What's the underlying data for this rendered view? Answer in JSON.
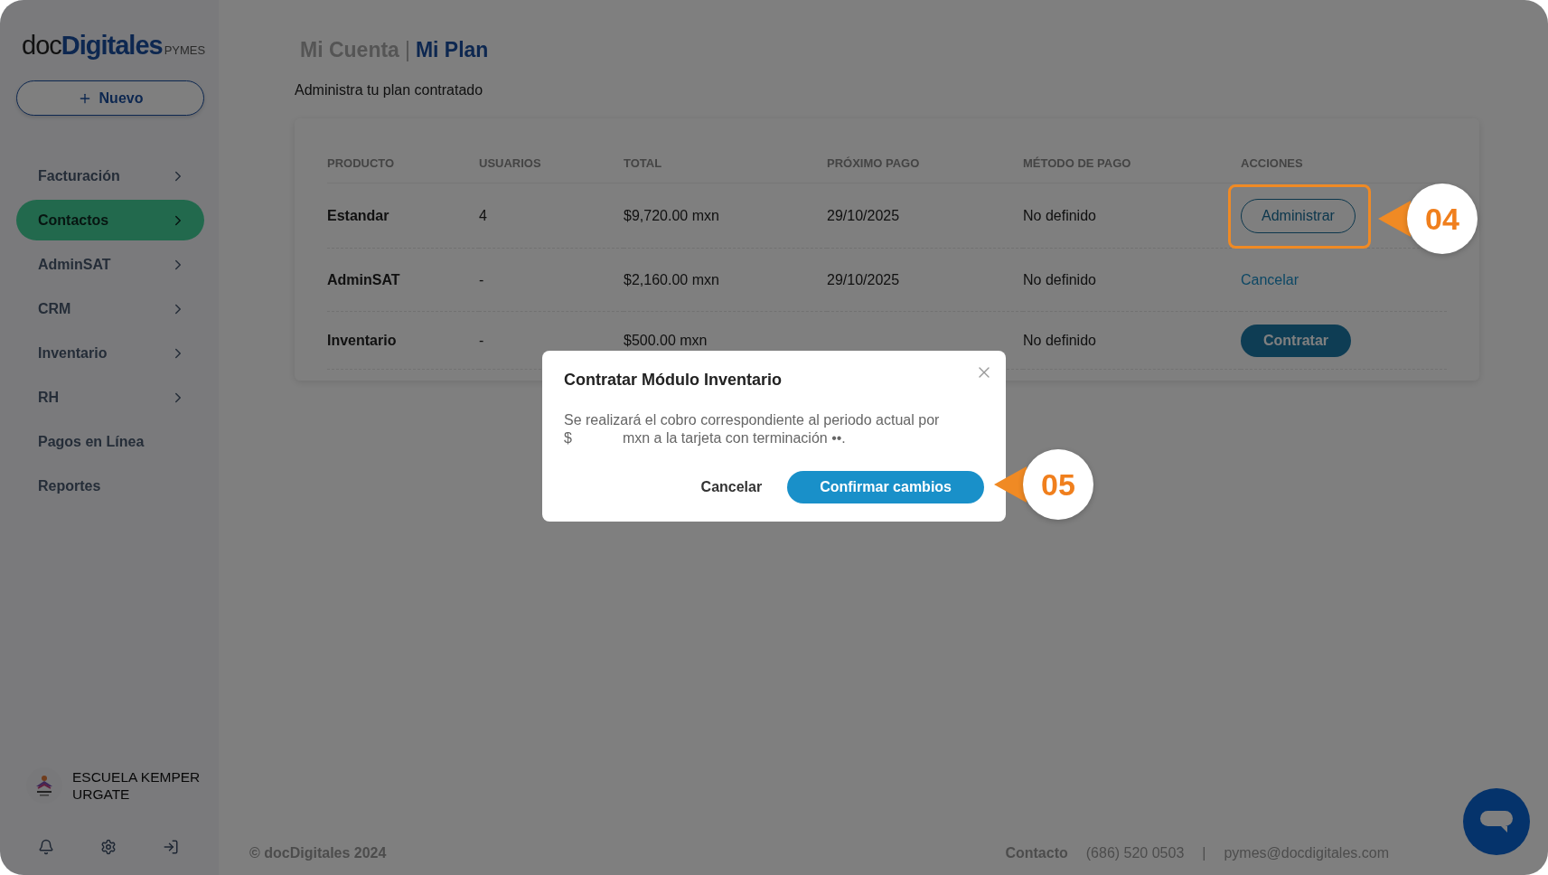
{
  "sidebar": {
    "logo": {
      "light": "doc",
      "bold": "Digitales",
      "suffix": "PYMES"
    },
    "new_button": {
      "label": "Nuevo"
    },
    "items": [
      {
        "label": "Facturación",
        "selected": false,
        "has_submenu": true
      },
      {
        "label": "Contactos",
        "selected": true,
        "has_submenu": true
      },
      {
        "label": "AdminSAT",
        "selected": false,
        "has_submenu": true
      },
      {
        "label": "CRM",
        "selected": false,
        "has_submenu": true
      },
      {
        "label": "Inventario",
        "selected": false,
        "has_submenu": true
      },
      {
        "label": "RH",
        "selected": false,
        "has_submenu": true
      },
      {
        "label": "Pagos en Línea",
        "selected": false,
        "has_submenu": false
      },
      {
        "label": "Reportes",
        "selected": false,
        "has_submenu": false
      }
    ],
    "user": {
      "name": "ESCUELA KEMPER URGATE"
    }
  },
  "header": {
    "parent": "Mi Cuenta",
    "separator": "|",
    "current": "Mi Plan",
    "subtitle": "Administra tu plan contratado"
  },
  "table": {
    "columns": [
      "PRODUCTO",
      "USUARIOS",
      "TOTAL",
      "PRÓXIMO PAGO",
      "MÉTODO DE PAGO",
      "ACCIONES"
    ],
    "rows": [
      {
        "product": "Estandar",
        "users": "4",
        "total": "$9,720.00 mxn",
        "next_payment": "29/10/2025",
        "method": "No definido",
        "action": {
          "kind": "outline",
          "label": "Administrar",
          "highlighted": true
        }
      },
      {
        "product": "AdminSAT",
        "users": "-",
        "total": "$2,160.00 mxn",
        "next_payment": "29/10/2025",
        "method": "No definido",
        "action": {
          "kind": "link",
          "label": "Cancelar",
          "highlighted": false
        }
      },
      {
        "product": "Inventario",
        "users": "-",
        "total": "$500.00 mxn",
        "method": "No definido",
        "action": {
          "kind": "filled",
          "label": "Contratar",
          "highlighted": false
        }
      }
    ]
  },
  "modal": {
    "title": "Contratar Módulo Inventario",
    "message_parts": [
      "Se realizará el cobro correspondiente al periodo actual por",
      "$",
      "mxn a la tarjeta con terminación ••."
    ],
    "cancel": "Cancelar",
    "confirm": "Confirmar cambios"
  },
  "callouts": [
    {
      "label": "04"
    },
    {
      "label": "05"
    }
  ],
  "footer": {
    "copyright": "© docDigitales 2024",
    "contact_label": "Contacto",
    "phone": "(686) 520 0503",
    "separator": "|",
    "email": "pymes@docdigitales.com"
  }
}
